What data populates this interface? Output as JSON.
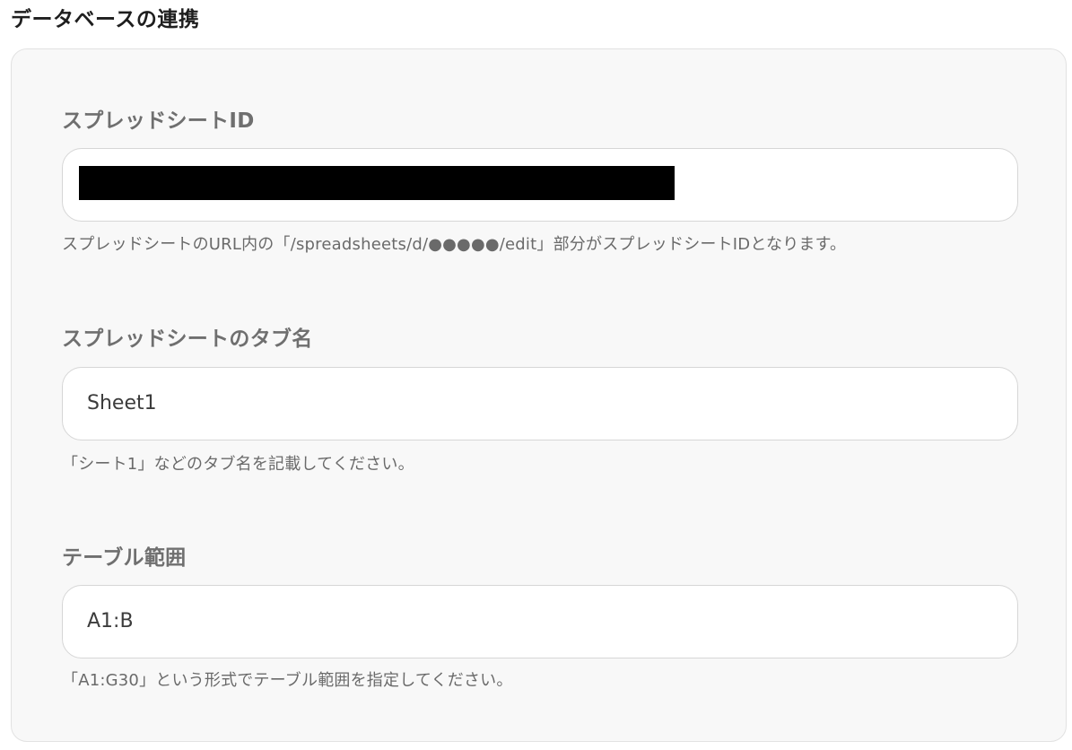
{
  "section": {
    "title": "データベースの連携"
  },
  "fields": [
    {
      "label": "スプレッドシートID",
      "value": "",
      "value_redacted": true,
      "hint": "スプレッドシートのURL内の「/spreadsheets/d/●●●●●/edit」部分がスプレッドシートIDとなります。"
    },
    {
      "label": "スプレッドシートのタブ名",
      "value": "Sheet1",
      "hint": "「シート1」などのタブ名を記載してください。"
    },
    {
      "label": "テーブル範囲",
      "value": "A1:B",
      "hint": "「A1:G30」という形式でテーブル範囲を指定してください。"
    }
  ]
}
